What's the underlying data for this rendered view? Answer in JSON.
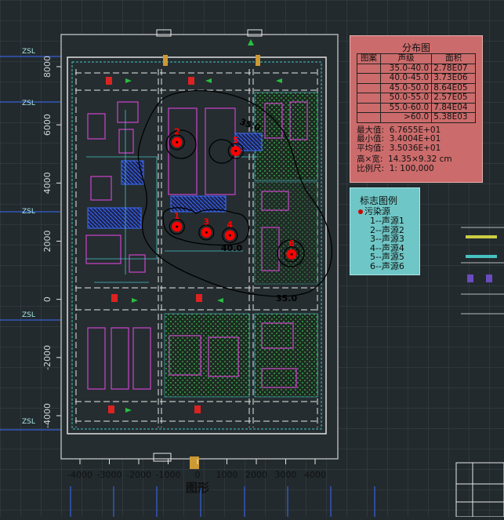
{
  "distribution": {
    "title": "分布图",
    "headers": [
      "图案",
      "声级",
      "面积"
    ],
    "rows": [
      {
        "level": "35.0-40.0",
        "area": "2.78E07"
      },
      {
        "level": "40.0-45.0",
        "area": "3.73E06"
      },
      {
        "level": "45.0-50.0",
        "area": "8.64E05"
      },
      {
        "level": "50.0-55.0",
        "area": "2.57E05"
      },
      {
        "level": "55.0-60.0",
        "area": "7.84E04"
      },
      {
        "level": ">60.0",
        "area": "5.38E03"
      }
    ],
    "max_label": "最大值:",
    "max_value": "6.7655E+01",
    "min_label": "最小值:",
    "min_value": "3.4004E+01",
    "avg_label": "平均值:",
    "avg_value": "3.5036E+01",
    "size_label": "高×宽:",
    "size_value": "14.35×9.32 cm",
    "scale_label": "比例尺:",
    "scale_value": "1: 100,000"
  },
  "markers_legend": {
    "title": "标志图例",
    "category": "污染源",
    "items": [
      "1--声源1",
      "2--声源2",
      "3--声源3",
      "4--声源4",
      "5--声源5",
      "6--声源6"
    ]
  },
  "map": {
    "caption": "图形",
    "x_ticks": [
      "-4000",
      "-3000",
      "-2000",
      "-1000",
      "0",
      "1000",
      "2000",
      "3000",
      "4000"
    ],
    "y_ticks": [
      "8000",
      "6000",
      "4000",
      "2000",
      "0",
      "-2000",
      "-4000"
    ],
    "contour_labels": [
      "35.0",
      "35.0",
      "40.0"
    ],
    "sources": [
      {
        "id": "1",
        "x": -700,
        "y": 2500
      },
      {
        "id": "2",
        "x": -700,
        "y": 5400
      },
      {
        "id": "3",
        "x": 300,
        "y": 2300
      },
      {
        "id": "4",
        "x": 1100,
        "y": 2200
      },
      {
        "id": "5",
        "x": 1300,
        "y": 5100
      },
      {
        "id": "6",
        "x": 3200,
        "y": 1550
      }
    ],
    "colors": {
      "frame": "#5e6a6e",
      "roads": "#e8e8e8",
      "green": "#1f8a3a",
      "contour": "#000000",
      "source": "#ff0000"
    }
  }
}
